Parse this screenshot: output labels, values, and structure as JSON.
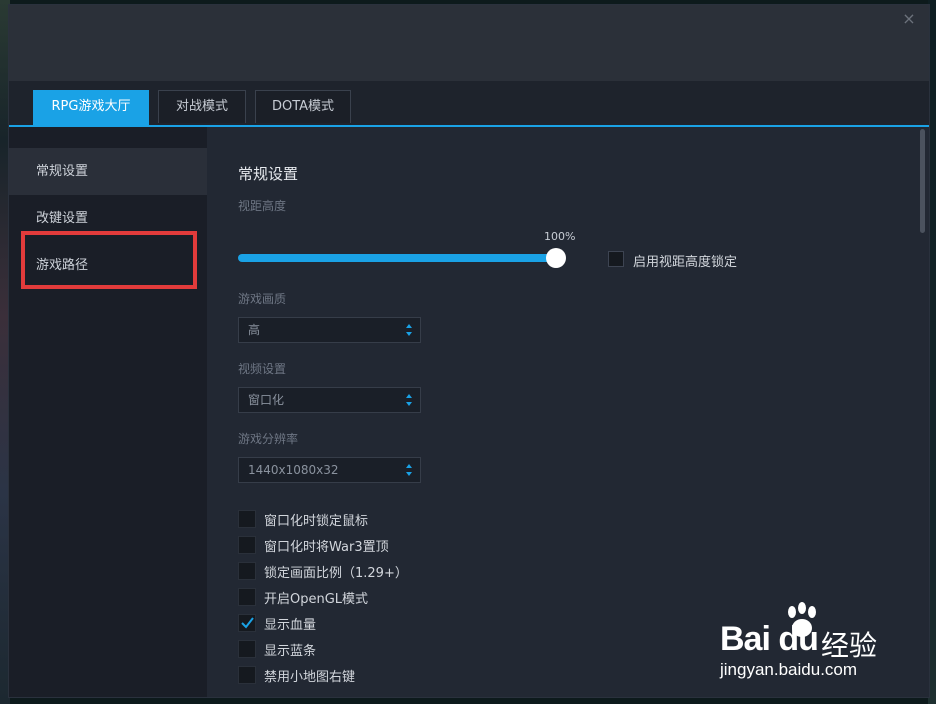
{
  "window": {
    "close_glyph": "×"
  },
  "tabs": [
    {
      "label": "RPG游戏大厅",
      "active": true
    },
    {
      "label": "对战模式",
      "active": false
    },
    {
      "label": "DOTA模式",
      "active": false
    }
  ],
  "sidebar": {
    "items": [
      {
        "label": "常规设置",
        "active": true
      },
      {
        "label": "改键设置",
        "active": false
      },
      {
        "label": "游戏路径",
        "active": false
      }
    ]
  },
  "content": {
    "section_title": "常规设置",
    "view_height": {
      "label": "视距高度",
      "value_text": "100%",
      "value": 1.0,
      "lock_label": "启用视距高度锁定",
      "lock_checked": false
    },
    "quality": {
      "label": "游戏画质",
      "value": "高"
    },
    "video": {
      "label": "视频设置",
      "value": "窗口化"
    },
    "resolution": {
      "label": "游戏分辨率",
      "value": "1440x1080x32"
    },
    "options": [
      {
        "label": "窗口化时锁定鼠标",
        "checked": false
      },
      {
        "label": "窗口化时将War3置顶",
        "checked": false
      },
      {
        "label": "锁定画面比例（1.29+）",
        "checked": false
      },
      {
        "label": "开启OpenGL模式",
        "checked": false
      },
      {
        "label": "显示血量",
        "checked": true
      },
      {
        "label": "显示蓝条",
        "checked": false
      },
      {
        "label": "禁用小地图右键",
        "checked": false
      }
    ]
  },
  "watermark": {
    "logo_text": "Bai du",
    "cn_text": "经验",
    "url": "jingyan.baidu.com"
  },
  "colors": {
    "accent": "#1aa2e6",
    "highlight_box": "#e23b3b"
  }
}
